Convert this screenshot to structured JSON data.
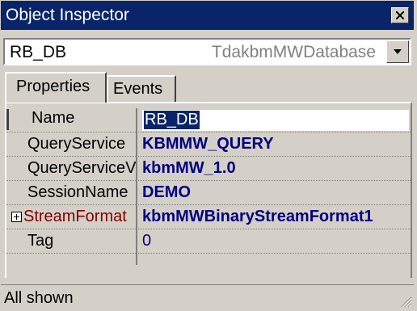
{
  "window": {
    "title": "Object Inspector"
  },
  "object_selector": {
    "name": "RB_DB",
    "type": "TdakbmMWDatabase"
  },
  "tabs": [
    {
      "label": "Properties",
      "active": true
    },
    {
      "label": "Events",
      "active": false
    }
  ],
  "properties": [
    {
      "name": "Name",
      "value": "RB_DB",
      "selected": true
    },
    {
      "name": "QueryService",
      "value": "KBMMW_QUERY"
    },
    {
      "name": "QueryServiceV",
      "value": "kbmMW_1.0"
    },
    {
      "name": "SessionName",
      "value": "DEMO"
    },
    {
      "name": "StreamFormat",
      "value": "kbmMWBinaryStreamFormat1",
      "expandable": true
    },
    {
      "name": "Tag",
      "value": "0"
    }
  ],
  "status": {
    "text": "All shown"
  },
  "colors": {
    "titlebar": "#0a246a",
    "face": "#d4d0c8",
    "value_text": "#000080",
    "object_property": "#800000"
  }
}
